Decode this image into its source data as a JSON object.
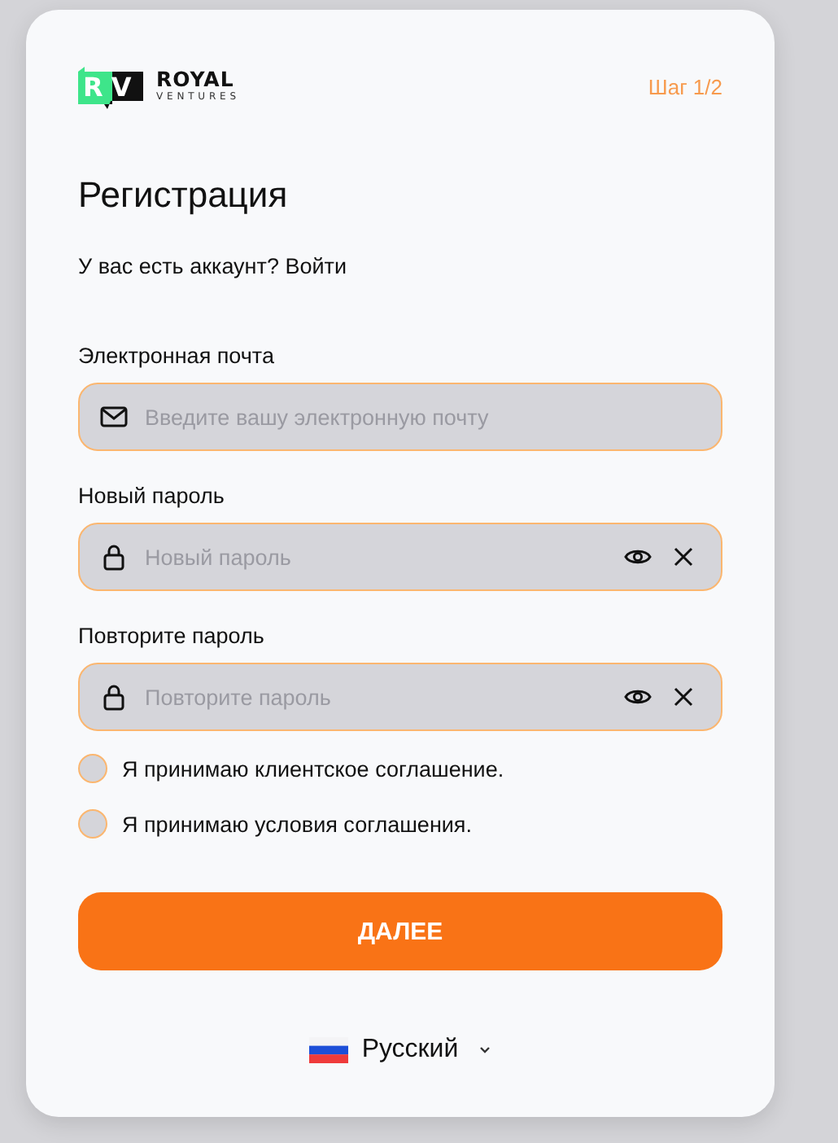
{
  "logo": {
    "mark": "RV",
    "name": "ROYAL",
    "tagline": "VENTURES"
  },
  "step": "Шаг 1/2",
  "title": "Регистрация",
  "account_prompt": {
    "text": "У вас есть аккаунт?",
    "link": "Войти"
  },
  "fields": [
    {
      "kind": "email",
      "label": "Электронная почта",
      "placeholder": "Введите вашу электронную почту"
    },
    {
      "kind": "password",
      "label": "Новый пароль",
      "placeholder": "Новый пароль"
    },
    {
      "kind": "password",
      "label": "Повторите пароль",
      "placeholder": "Повторите пароль"
    }
  ],
  "agreements": [
    {
      "label": "Я принимаю клиентское соглашение.",
      "checked": false
    },
    {
      "label": "Я принимаю условия соглашения.",
      "checked": false
    }
  ],
  "submit": "ДАЛЕЕ",
  "language": "Русский"
}
